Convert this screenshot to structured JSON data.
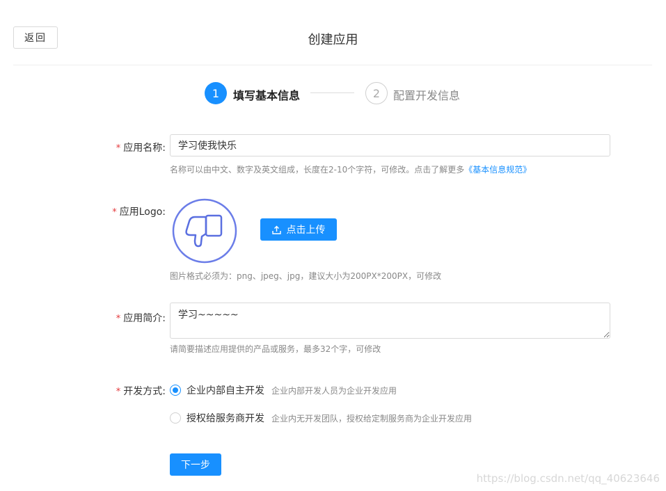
{
  "header": {
    "back_label": "返回",
    "title": "创建应用"
  },
  "steps": [
    {
      "number": "1",
      "label": "填写基本信息",
      "state": "active"
    },
    {
      "number": "2",
      "label": "配置开发信息",
      "state": "pending"
    }
  ],
  "form": {
    "required_mark": "*",
    "app_name": {
      "label": "应用名称:",
      "value": "学习使我快乐",
      "hint": "名称可以由中文、数字及英文组成，长度在2-10个字符，可修改。点击了解更多",
      "hint_link": "《基本信息规范》"
    },
    "app_logo": {
      "label": "应用Logo:",
      "logo_icon": "thumbs-down-icon",
      "upload_label": "点击上传",
      "upload_icon": "upload-icon",
      "hint": "图片格式必须为：png、jpeg、jpg，建议大小为200PX*200PX，可修改"
    },
    "app_desc": {
      "label": "应用简介:",
      "value": "学习~~~~~",
      "hint": "请简要描述应用提供的产品或服务，最多32个字，可修改"
    },
    "dev_mode": {
      "label": "开发方式:",
      "options": [
        {
          "label": "企业内部自主开发",
          "desc": "企业内部开发人员为企业开发应用",
          "checked": true
        },
        {
          "label": "授权给服务商开发",
          "desc": "企业内无开发团队，授权给定制服务商为企业开发应用",
          "checked": false
        }
      ]
    },
    "next_label": "下一步"
  },
  "watermark": "https://blog.csdn.net/qq_40623646",
  "colors": {
    "primary": "#1890ff",
    "required": "#e4393c",
    "hint": "#888888",
    "logo_stroke": "#6b7de8"
  }
}
